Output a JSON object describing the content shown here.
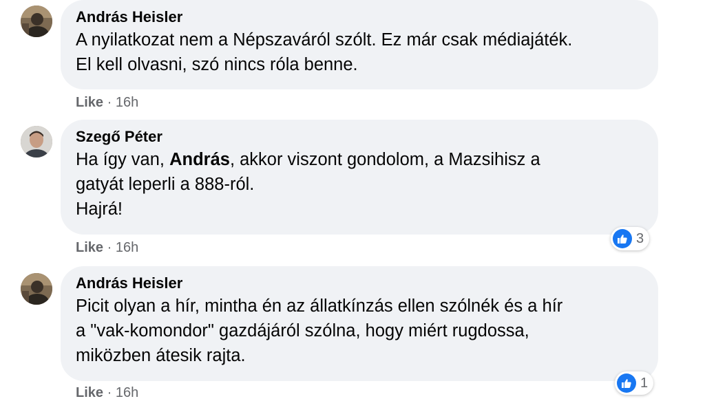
{
  "colors": {
    "bubble": "#f0f2f5",
    "meta": "#65676b",
    "like_blue": "#1877f2"
  },
  "comments": [
    {
      "author": "András Heisler",
      "lines": [
        "A nyilatkozat nem a Népszaváról szólt. Ez már csak médiajáték.",
        "El kell olvasni, szó nincs róla benne."
      ],
      "like_label": "Like",
      "separator": "·",
      "time": "16h"
    },
    {
      "author": "Szegő Péter",
      "line1_before": "Ha így van, ",
      "line1_mention": "András",
      "line1_after": ", akkor viszont gondolom, a Mazsihisz a",
      "lines": [
        "gatyát leperli a 888-ról.",
        "Hajrá!"
      ],
      "like_label": "Like",
      "separator": "·",
      "time": "16h",
      "reaction_icon": "thumbs-up-icon",
      "reaction_count": "3"
    },
    {
      "author": "András Heisler",
      "lines": [
        "Picit olyan a hír, mintha én az állatkínzás ellen szólnék és a hír",
        "a \"vak-komondor\" gazdájáról szólna, hogy miért rugdossa,",
        "miközben átesik rajta."
      ],
      "like_label": "Like",
      "separator": "·",
      "time": "16h",
      "reaction_icon": "thumbs-up-icon",
      "reaction_count": "1"
    }
  ]
}
